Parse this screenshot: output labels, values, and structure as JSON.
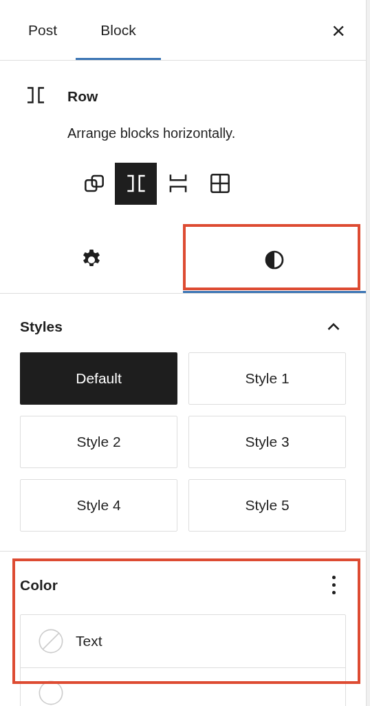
{
  "tabs": [
    {
      "label": "Post",
      "selected": false
    },
    {
      "label": "Block",
      "selected": true
    }
  ],
  "close": "×",
  "block": {
    "title": "Row",
    "description": "Arrange blocks horizontally."
  },
  "variations": [
    {
      "kind": "group",
      "selected": false
    },
    {
      "kind": "row",
      "selected": true
    },
    {
      "kind": "stack",
      "selected": false
    },
    {
      "kind": "grid",
      "selected": false
    }
  ],
  "inspector_tabs": [
    {
      "kind": "settings",
      "selected": false,
      "highlighted": false
    },
    {
      "kind": "styles",
      "selected": true,
      "highlighted": true
    }
  ],
  "styles_panel": {
    "title": "Styles",
    "expanded": true,
    "styles": [
      {
        "label": "Default",
        "selected": true
      },
      {
        "label": "Style 1",
        "selected": false
      },
      {
        "label": "Style 2",
        "selected": false
      },
      {
        "label": "Style 3",
        "selected": false
      },
      {
        "label": "Style 4",
        "selected": false
      },
      {
        "label": "Style 5",
        "selected": false
      }
    ]
  },
  "color_panel": {
    "title": "Color",
    "highlighted": true,
    "items": [
      {
        "label": "Text"
      }
    ]
  }
}
